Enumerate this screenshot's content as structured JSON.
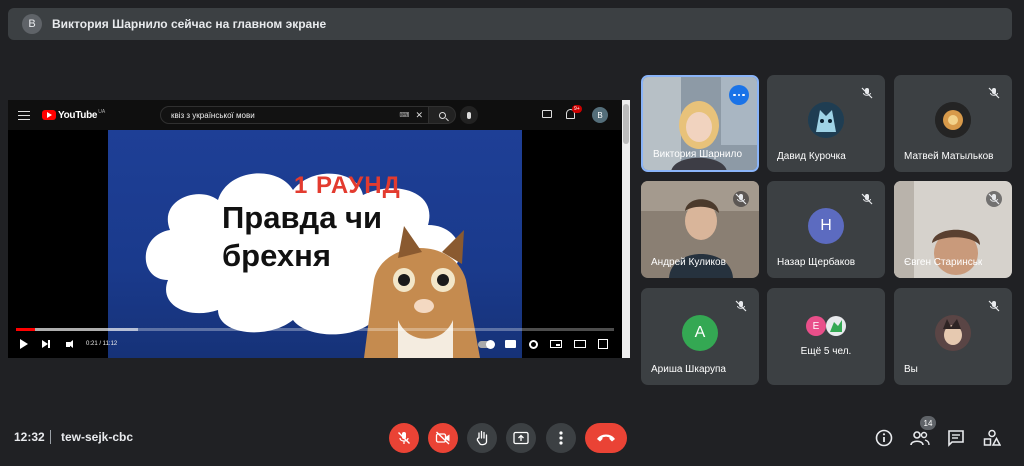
{
  "banner": {
    "avatar_letter": "В",
    "text": "Виктория Шарнило сейчас на главном экране"
  },
  "presentation": {
    "youtube": {
      "logo_text": "YouTube",
      "logo_sup": "UA",
      "search_value": "квіз з української мови",
      "notification_count": "9+",
      "user_letter": "В"
    },
    "video": {
      "round_text": "1 РАУНД",
      "title_line1": "Правда чи",
      "title_line2": "брехня",
      "time": "0:21 / 11:12",
      "progress": 0.031
    }
  },
  "tiles": [
    {
      "name": "Виктория Шарнило",
      "type": "video",
      "active": true
    },
    {
      "name": "Давид Курочка",
      "type": "avatar",
      "muted": true
    },
    {
      "name": "Матвей Матыльков",
      "type": "avatar",
      "muted": true
    },
    {
      "name": "Андрей Куликов",
      "type": "video",
      "muted": true
    },
    {
      "name": "Назар Щербаков",
      "type": "avatar",
      "letter": "Н",
      "color": "#5c6bc0",
      "muted": true
    },
    {
      "name": "Євген Старинськ",
      "type": "video",
      "muted": true
    },
    {
      "name": "Ариша Шкарупа",
      "type": "avatar",
      "letter": "A",
      "color": "#34a853",
      "muted": true
    },
    {
      "name": "Ещё 5 чел.",
      "type": "group",
      "letter": "E"
    },
    {
      "name": "Вы",
      "type": "avatar",
      "muted": true
    }
  ],
  "bottom": {
    "time": "12:32",
    "meeting_code": "tew-sejk-cbc",
    "participants_count": "14"
  },
  "colors": {
    "accent": "#8ab4f8",
    "danger": "#ea4335",
    "bg": "#202124",
    "tile": "#3c4043"
  }
}
